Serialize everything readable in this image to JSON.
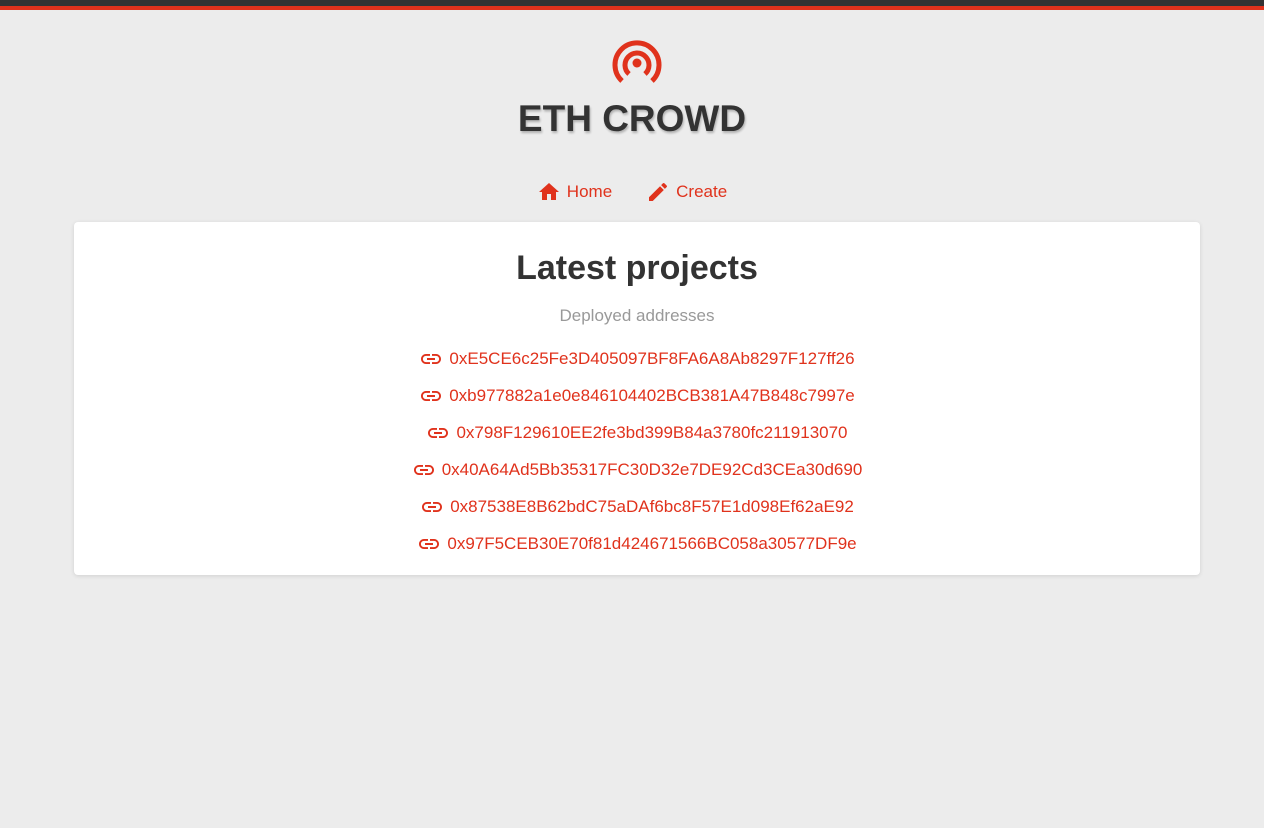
{
  "brand": {
    "title": "ETH CROWD",
    "logo_icon": "broadcast-icon",
    "accent_color": "#e0321c",
    "text_color": "#333333"
  },
  "nav": {
    "items": [
      {
        "label": "Home",
        "icon": "home-icon"
      },
      {
        "label": "Create",
        "icon": "pencil-icon"
      }
    ]
  },
  "main": {
    "title": "Latest projects",
    "subtitle": "Deployed addresses",
    "link_icon": "link-icon",
    "addresses": [
      "0xE5CE6c25Fe3D405097BF8FA6A8Ab8297F127ff26",
      "0xb977882a1e0e846104402BCB381A47B848c7997e",
      "0x798F129610EE2fe3bd399B84a3780fc211913070",
      "0x40A64Ad5Bb35317FC30D32e7DE92Cd3CEa30d690",
      "0x87538E8B62bdC75aDAf6bc8F57E1d098Ef62aE92",
      "0x97F5CEB30E70f81d424671566BC058a30577DF9e"
    ]
  }
}
